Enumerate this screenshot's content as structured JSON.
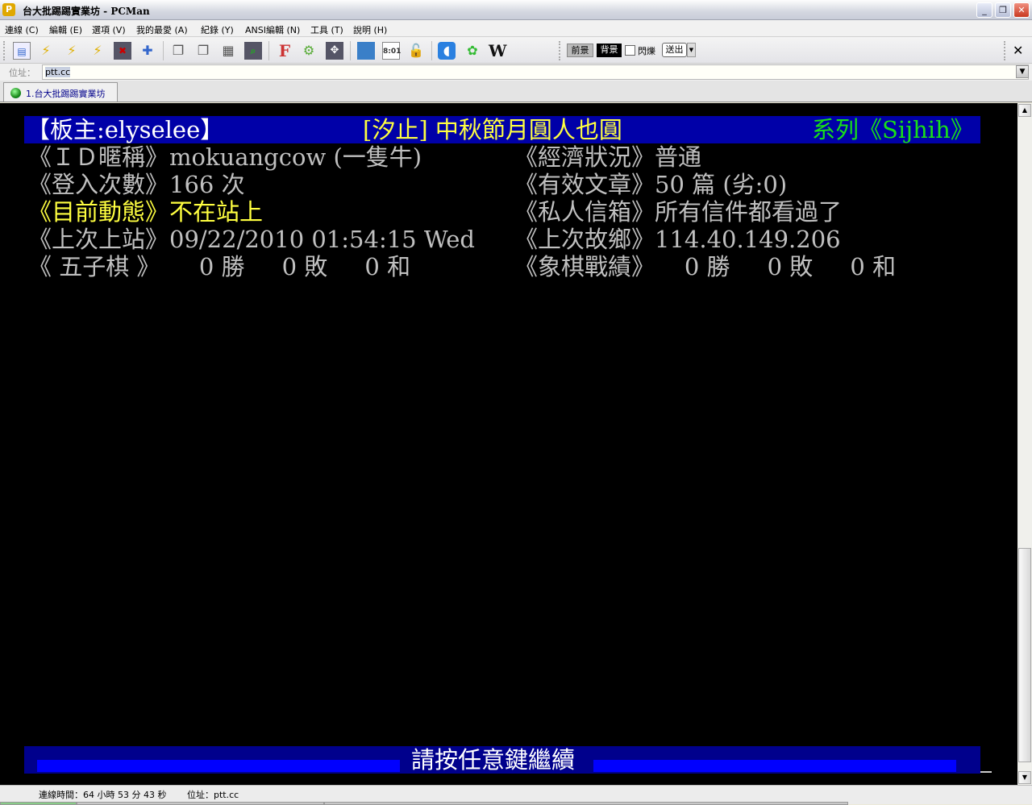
{
  "window": {
    "title": "台大批踢踢實業坊 - PCMan",
    "app_icon": "pcman-icon"
  },
  "menu": [
    "連線 (C)",
    "編輯 (E)",
    "選項 (V)",
    "我的最愛 (A)",
    "紀錄 (Y)",
    "ANSI編輯 (N)",
    "工具 (T)",
    "說明 (H)"
  ],
  "toolbar": {
    "fg": "前景",
    "bg": "背景",
    "blink": "閃爍",
    "send": "送出",
    "close": "✕"
  },
  "address": {
    "label": "位址：",
    "value": "ptt.cc"
  },
  "tabs": [
    {
      "label": "1.台大批踢踢實業坊"
    }
  ],
  "terminal": {
    "header": {
      "moderator": "【板主:elyselee】",
      "title": "[汐止] 中秋節月圓人也圓",
      "series": "系列《Sijhih》"
    },
    "rows": [
      {
        "l_label": "《ＩＤ暱稱》",
        "l_value": "mokuangcow (一隻牛)",
        "r_label": "《經濟狀況》",
        "r_value": "普通"
      },
      {
        "l_label": "《登入次數》",
        "l_value": "166 次",
        "r_label": "《有效文章》",
        "r_value": "50 篇 (劣:0)"
      },
      {
        "l_label": "《目前動態》",
        "l_value": "不在站上",
        "r_label": "《私人信箱》",
        "r_value": "所有信件都看過了"
      },
      {
        "l_label": "《上次上站》",
        "l_value": "09/22/2010 01:54:15 Wed",
        "r_label": "《上次故鄉》",
        "r_value": "114.40.149.206"
      },
      {
        "l_label": "《 五子棋 》",
        "l_value": "    0 勝     0 敗     0 和",
        "r_label": "《象棋戰績》",
        "r_value": "    0 勝     0 敗     0 和"
      }
    ],
    "footer": "請按任意鍵繼續"
  },
  "status": {
    "connection_time": "連線時間：64 小時 53 分 43 秒",
    "address": "位址：ptt.cc"
  },
  "colors": {
    "header_bg": "#0000a8",
    "footer_bg": "#00008c",
    "highlight": "#ffff40",
    "series": "#18e018"
  }
}
